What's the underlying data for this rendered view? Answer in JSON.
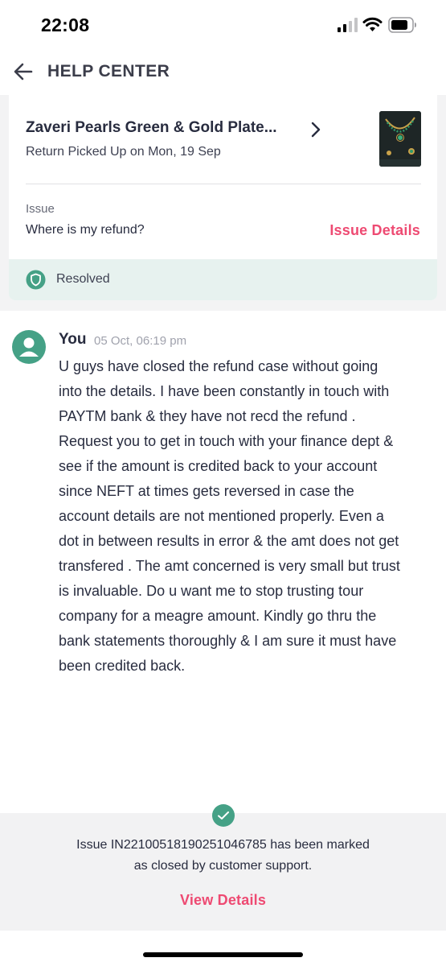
{
  "status_bar": {
    "time": "22:08",
    "icons": [
      "signal-icon",
      "wifi-icon",
      "battery-icon"
    ]
  },
  "header": {
    "title": "HELP CENTER",
    "back_icon": "back-arrow-icon"
  },
  "order": {
    "product_name": "Zaveri Pearls Green & Gold Plate...",
    "status": "Return Picked Up on Mon, 19 Sep",
    "thumbnail_icon": "product-thumbnail"
  },
  "issue": {
    "label": "Issue",
    "text": "Where is my refund?",
    "details_link": "Issue Details",
    "resolution": "Resolved"
  },
  "message": {
    "sender": "You",
    "timestamp": "05 Oct, 06:19 pm",
    "body": "U guys have closed the refund case without going into the details. I have been constantly in touch with PAYTM bank & they have not recd the refund . Request you to get in touch with your finance dept & see if the amount is credited back to your account since NEFT at times gets reversed in case the account details are not mentioned properly. Even a dot in between results in error & the amt does not get transfered . The amt concerned is very small but trust is invaluable. Do u want me to stop trusting tour company for a meagre amount. Kindly go thru the bank statements thoroughly & I am sure it must have been credited back."
  },
  "closed_notice": {
    "line1": "Issue IN22100518190251046785 has been marked",
    "line2": "as closed by customer support.",
    "link": "View Details"
  },
  "colors": {
    "accent": "#ee4a72",
    "success": "#45a186",
    "resolved_bg": "#e7f2ef",
    "panel_bg": "#f3f3f4"
  }
}
